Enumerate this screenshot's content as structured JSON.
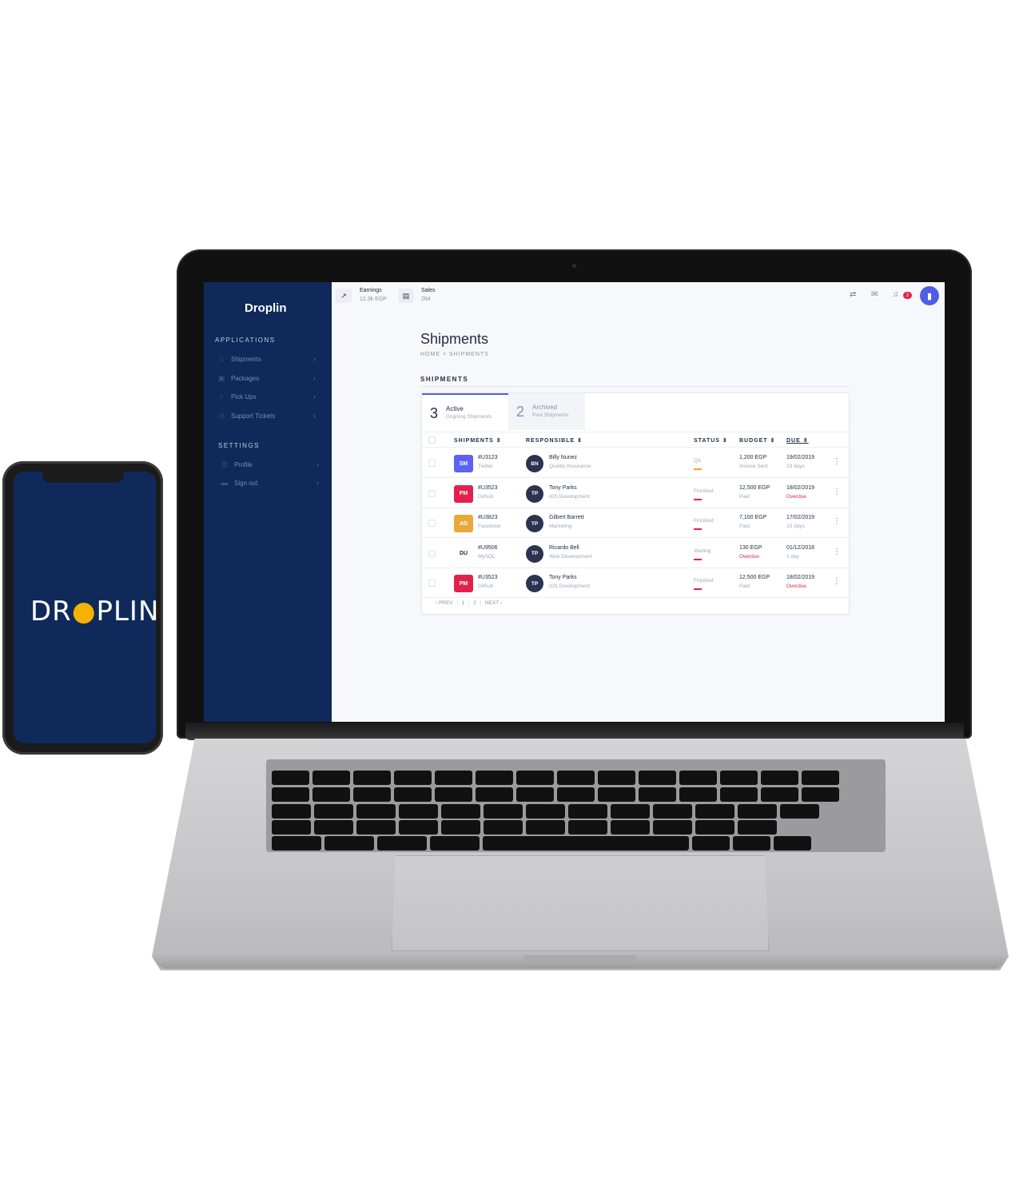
{
  "sidebar": {
    "brand": "Droplin",
    "section_applications": "APPLICATIONS",
    "items": [
      {
        "label": "Shipments",
        "icon": "graduation-cap-icon"
      },
      {
        "label": "Packages",
        "icon": "box-icon"
      },
      {
        "label": "Pick Ups",
        "icon": "circle-icon"
      },
      {
        "label": "Support Tickets",
        "icon": "clock-icon"
      }
    ],
    "section_settings": "SETTINGS",
    "settings_items": [
      {
        "label": "Profile",
        "icon": "sliders-icon"
      },
      {
        "label": "Sign out",
        "icon": "folder-icon"
      }
    ]
  },
  "topbar": {
    "earnings_label": "Earnings",
    "earnings_value": "12.3k EGP",
    "sales_label": "Sales",
    "sales_value": "264",
    "notification_count": "2"
  },
  "page": {
    "title": "Shipments",
    "breadcrumb": "HOME > SHIPMENTS",
    "section_heading": "SHIPMENTS"
  },
  "tabs": [
    {
      "count": "3",
      "label": "Active",
      "sub": "Ongoing Shipments"
    },
    {
      "count": "2",
      "label": "Archived",
      "sub": "Past Shipments"
    }
  ],
  "table": {
    "headers": [
      "SHIPMENTS ⇕",
      "RESPONSIBLE ⇕",
      "STATUS ⇕",
      "BUDGET ⇕",
      "DUE ⇕"
    ],
    "rows": [
      {
        "initials": "SM",
        "color": "#5b63f0",
        "id": "#U3123",
        "company": "Twitter",
        "person_initials": "BN",
        "person": "Billy Nunez",
        "role": "Quality Assurance",
        "status": "QA",
        "status_color": "#f5a623",
        "budget": "1,200 EGP",
        "budget_sub": "Invoice Sent",
        "budget_sub_red": false,
        "due": "19/02/2019",
        "due_sub": "18 days",
        "due_sub_red": false
      },
      {
        "initials": "PM",
        "color": "#e0234d",
        "id": "#U3523",
        "company": "Github",
        "person_initials": "TP",
        "person": "Tony Parks",
        "role": "iOS Development",
        "status": "Finished",
        "status_color": "#e0234d",
        "budget": "12,500 EGP",
        "budget_sub": "Paid",
        "budget_sub_red": false,
        "due": "18/02/2019",
        "due_sub": "Overdue",
        "due_sub_red": true
      },
      {
        "initials": "AD",
        "color": "#e8a93a",
        "id": "#U3823",
        "company": "Facebook",
        "person_initials": "TP",
        "person": "Gilbert Barrett",
        "role": "Marketing",
        "status": "Finished",
        "status_color": "#e0234d",
        "budget": "7,100 EGP",
        "budget_sub": "Paid",
        "budget_sub_red": false,
        "due": "17/02/2019",
        "due_sub": "15 days",
        "due_sub_red": false
      },
      {
        "initials": "DU",
        "color": "#ffffff",
        "id": "#U9506",
        "company": "MySQL",
        "person_initials": "TP",
        "person": "Ricardo Bell",
        "role": "Web Development",
        "status": "Waiting",
        "status_color": "#e0234d",
        "budget": "130 EGP",
        "budget_sub": "Overdue",
        "budget_sub_red": true,
        "due": "01/12/2018",
        "due_sub": "1 day",
        "due_sub_red": false
      },
      {
        "initials": "PM",
        "color": "#e0234d",
        "id": "#U3523",
        "company": "Github",
        "person_initials": "TP",
        "person": "Tony Parks",
        "role": "iOS Development",
        "status": "Finished",
        "status_color": "#e0234d",
        "budget": "12,500 EGP",
        "budget_sub": "Paid",
        "budget_sub_red": false,
        "due": "18/02/2019",
        "due_sub": "Overdue",
        "due_sub_red": true
      }
    ]
  },
  "pager": {
    "prev": "‹ PREV",
    "pages": [
      "1",
      "2"
    ],
    "next": "NEXT ›"
  },
  "phone": {
    "logo_left": "DR",
    "logo_pin": "●",
    "logo_right": "PLIN"
  },
  "colors": {
    "sidebar": "#0f2a5a",
    "accent": "#4e5ee4",
    "danger": "#e0234d",
    "pin": "#f5b300"
  }
}
